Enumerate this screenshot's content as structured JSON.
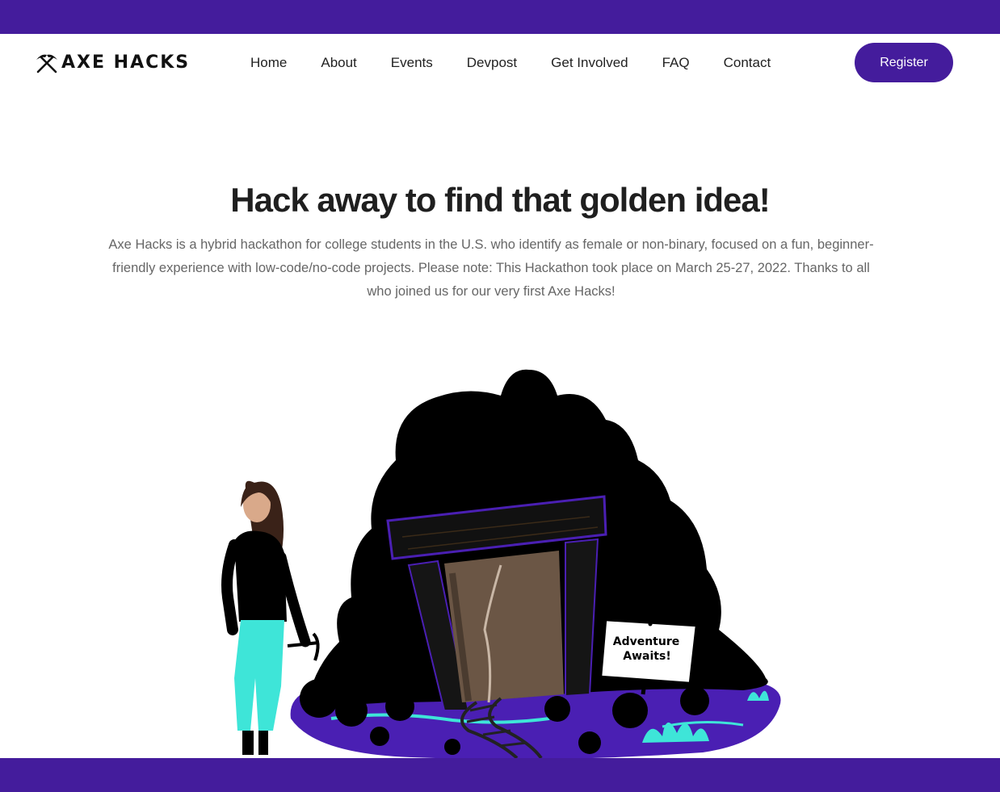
{
  "brand": {
    "name": "AXE HACKS",
    "icon": "crossed-pickaxes-icon"
  },
  "nav": {
    "links": [
      "Home",
      "About",
      "Events",
      "Devpost",
      "Get Involved",
      "FAQ",
      "Contact"
    ],
    "register_label": "Register"
  },
  "hero": {
    "title": "Hack away to find that golden idea!",
    "description": "Axe Hacks is a hybrid hackathon for college students in the U.S. who identify as female or non-binary, focused on a fun, beginner-friendly experience with low-code/no-code projects. Please note: This Hackathon took place on March 25-27, 2022. Thanks to all who joined us for our very first Axe Hacks!"
  },
  "illustration": {
    "sign_line1": "Adventure",
    "sign_line2": "Awaits!"
  },
  "colors": {
    "brand_purple": "#441c9c",
    "accent_teal": "#3ee5d8",
    "text_dark": "#1f1f1f",
    "text_muted": "#666666"
  }
}
